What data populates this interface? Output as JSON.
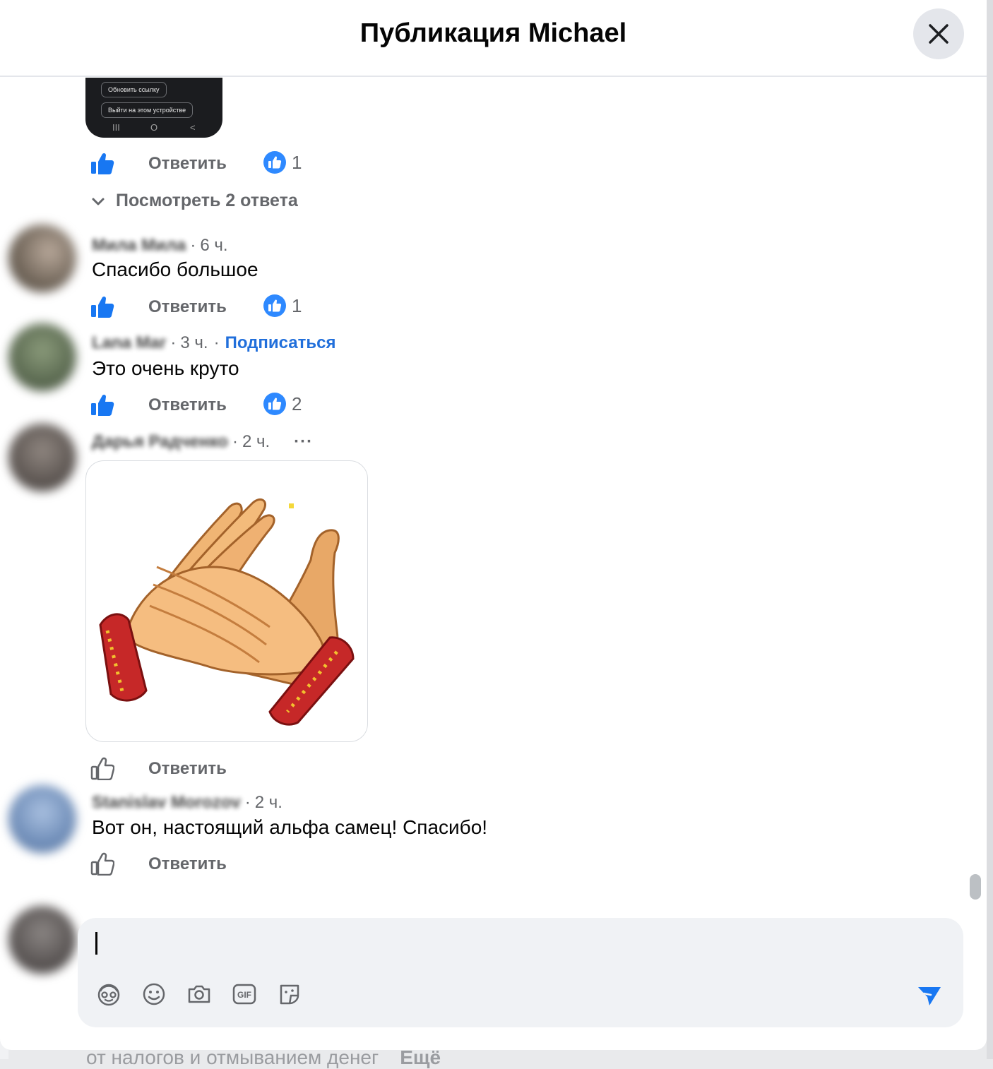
{
  "header": {
    "title": "Публикация Michael"
  },
  "previous_image": {
    "buttons": [
      "Обновить ссылку",
      "Выйти на этом устройстве"
    ],
    "nav_glyphs": [
      "III",
      "O",
      "<"
    ]
  },
  "thread": {
    "reactions_count": "1",
    "view_replies": "Посмотреть 2 ответа"
  },
  "comments": [
    {
      "author": "Мила Мила",
      "time": "6 ч.",
      "text": "Спасибо большое",
      "reactions": "1"
    },
    {
      "author": "Lana Mar",
      "time": "3 ч.",
      "follow": "Подписаться",
      "text": "Это очень круто",
      "reactions": "2"
    },
    {
      "author": "Дарья Радченко",
      "time": "2 ч.",
      "more": "···"
    },
    {
      "author": "Stanislav Morozov",
      "time": "2 ч.",
      "text": "Вот он, настоящий альфа самец! Спасибо!"
    }
  ],
  "labels": {
    "reply": "Ответить",
    "separator": "·"
  },
  "background": {
    "snippet": "от налогов и отмыванием денег",
    "more": "Ещё"
  },
  "colors": {
    "link": "#216fdb",
    "reaction": "#2e89ff",
    "muted": "#65676b",
    "composer_bg": "#f0f2f5"
  },
  "composer_tools": [
    "avatar-sticker-icon",
    "emoji-icon",
    "camera-icon",
    "gif-icon",
    "sticker-icon",
    "send-icon"
  ]
}
